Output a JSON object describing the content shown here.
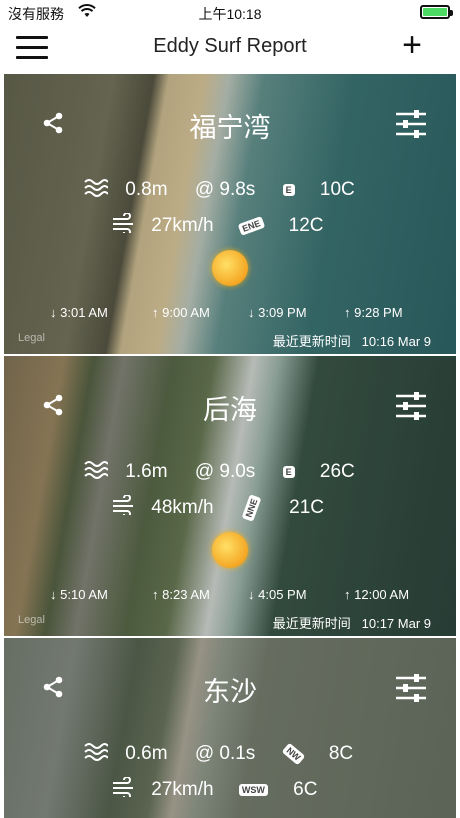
{
  "status": {
    "carrier": "沒有服務",
    "time": "上午10:18"
  },
  "nav": {
    "title": "Eddy Surf Report"
  },
  "cards": [
    {
      "name": "福宁湾",
      "swell": "0.8m",
      "period": "@ 9.8s",
      "swell_dir": "E",
      "water_temp": "10C",
      "wind": "27km/h",
      "wind_dir": "ENE",
      "air_temp": "12C",
      "tides": [
        "3:01 AM",
        "9:00 AM",
        "3:09 PM",
        "9:28 PM"
      ],
      "updated_label": "最近更新时间",
      "updated_time": "10:16 Mar 9",
      "legal": "Legal"
    },
    {
      "name": "后海",
      "swell": "1.6m",
      "period": "@ 9.0s",
      "swell_dir": "E",
      "water_temp": "26C",
      "wind": "48km/h",
      "wind_dir": "NNE",
      "air_temp": "21C",
      "tides": [
        "5:10 AM",
        "8:23 AM",
        "4:05 PM",
        "12:00 AM"
      ],
      "updated_label": "最近更新时间",
      "updated_time": "10:17 Mar 9",
      "legal": "Legal"
    },
    {
      "name": "东沙",
      "swell": "0.6m",
      "period": "@ 0.1s",
      "swell_dir": "NW",
      "water_temp": "8C",
      "wind": "27km/h",
      "wind_dir": "WSW",
      "air_temp": "6C"
    }
  ]
}
